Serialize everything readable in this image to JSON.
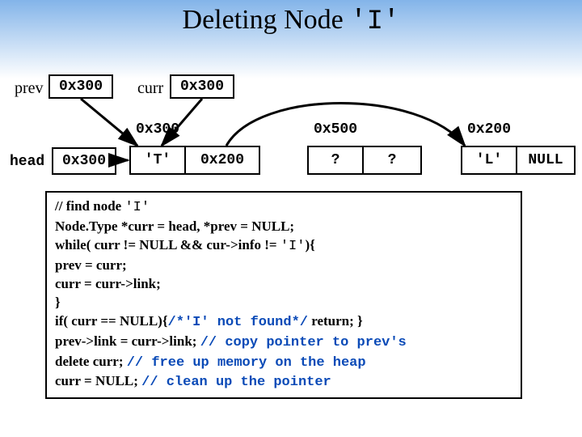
{
  "title_plain": "Deleting Node ",
  "title_mono": "'I'",
  "pointers": {
    "prev_label": "prev",
    "prev_val": "0x300",
    "curr_label": "curr",
    "curr_val": "0x300",
    "head_label": "head",
    "head_val": "0x300"
  },
  "addrs": {
    "n1": "0x300",
    "n2": "0x500",
    "n3": "0x200"
  },
  "nodes": {
    "n1": {
      "info": "'T'",
      "link": "0x200"
    },
    "n2": {
      "info": "?",
      "link": "?"
    },
    "n3": {
      "info": "'L'",
      "link": "NULL"
    }
  },
  "code": {
    "l1a": "// find node ",
    "l1b": "'I'",
    "l2": "Node.Type *curr = head, *prev = NULL;",
    "l3a": "while( curr != NULL  &&  cur->info != ",
    "l3b": "'I'",
    "l3c": "){",
    "l4": "  prev = curr;",
    "l5": "  curr = curr->link;",
    "l6": "}",
    "l7a": "if( curr == NULL){",
    "l7b": "/*'I' not found*/",
    "l7c": " return; }",
    "l8a": "prev->link = curr->link; ",
    "l8b": "// copy pointer to prev's",
    "l9a": "delete curr; ",
    "l9b": "// free up memory on the heap",
    "l10a": "curr = NULL; ",
    "l10b": "// clean up the pointer"
  }
}
